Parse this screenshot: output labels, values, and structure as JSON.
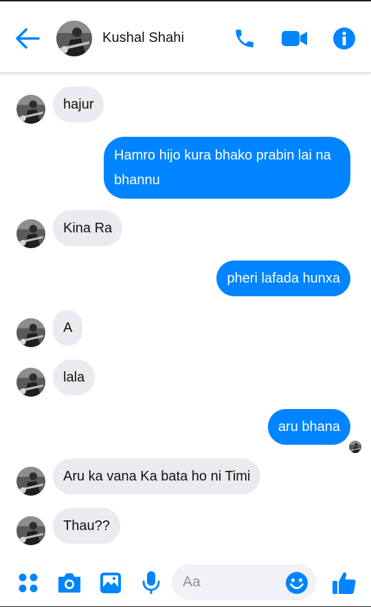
{
  "header": {
    "contact_name": "Kushal Shahi"
  },
  "messages": [
    {
      "direction": "in",
      "text": "hajur"
    },
    {
      "direction": "out",
      "text": "Hamro hijo kura bhako prabin lai na bhannu"
    },
    {
      "direction": "in",
      "text": "Kina Ra"
    },
    {
      "direction": "out",
      "text": "pheri lafada hunxa"
    },
    {
      "direction": "in",
      "text": "A"
    },
    {
      "direction": "in",
      "text": "lala"
    },
    {
      "direction": "out",
      "text": "aru bhana"
    },
    {
      "direction": "in",
      "text": "Aru ka vana Ka bata ho ni Timi"
    },
    {
      "direction": "in",
      "text": "Thau??"
    }
  ],
  "composer": {
    "placeholder": "Aa"
  },
  "icons": {
    "back": "arrow-left-icon",
    "call": "phone-icon",
    "video": "video-camera-icon",
    "info": "info-icon",
    "apps": "grid-dots-icon",
    "camera": "camera-icon",
    "gallery": "image-icon",
    "mic": "microphone-icon",
    "emoji": "smiley-icon",
    "like": "thumbs-up-icon"
  },
  "colors": {
    "accent": "#0084ff",
    "incoming_bubble": "#e9ebee",
    "outgoing_bubble": "#0084ff"
  }
}
